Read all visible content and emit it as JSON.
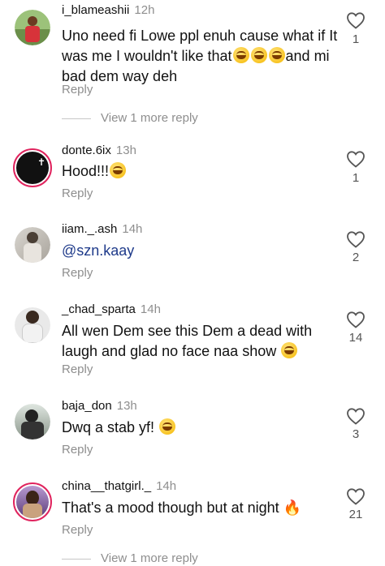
{
  "comments": [
    {
      "user": "i_blameashii",
      "time": "12h",
      "text": "Uno need fi Lowe ppl enuh cause what if It was me I wouldn't like that",
      "emoji_after": 3,
      "tail": "and mi bad dem way deh",
      "reply": "Reply",
      "likes": "1",
      "view_more": "View 1 more reply"
    },
    {
      "user": "donte.6ix",
      "time": "13h",
      "text": "Hood!!!",
      "emoji_after": 1,
      "reply": "Reply",
      "likes": "1"
    },
    {
      "user": "iiam._.ash",
      "time": "14h",
      "text": "@szn.kaay",
      "reply": "Reply",
      "likes": "2"
    },
    {
      "user": "_chad_sparta",
      "time": "14h",
      "text": "All wen Dem see this Dem a dead with laugh and glad no face naa show",
      "emoji_after": 1,
      "reply": "Reply",
      "likes": "14"
    },
    {
      "user": "baja_don",
      "time": "13h",
      "text": "Dwq a stab yf!",
      "emoji_after": 1,
      "reply": "Reply",
      "likes": "3"
    },
    {
      "user": "china__thatgirl._",
      "time": "14h",
      "text": "That's a mood though but at night",
      "fire": "🔥",
      "reply": "Reply",
      "likes": "21",
      "view_more": "View 1 more reply"
    }
  ],
  "colors": {
    "accent_ring": "#e0245e",
    "muted": "#8e8e8e",
    "mention": "#1e3a8a"
  },
  "icons": {
    "like": "heart-outline-icon",
    "laugh": "grinning-emoji",
    "fire": "fire-emoji"
  }
}
